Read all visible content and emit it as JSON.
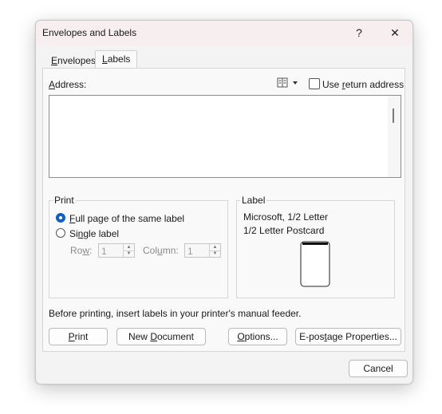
{
  "window": {
    "title": "Envelopes and Labels",
    "help_glyph": "?",
    "close_glyph": "✕"
  },
  "tabs": [
    {
      "label_pre": "",
      "label_ul": "E",
      "label_post": "nvelopes"
    },
    {
      "label_pre": "",
      "label_ul": "L",
      "label_post": "abels"
    }
  ],
  "address": {
    "label_pre": "",
    "label_ul": "A",
    "label_post": "ddress:",
    "value": "",
    "use_return": {
      "pre": "Use ",
      "ul": "r",
      "post": "eturn address",
      "checked": false
    }
  },
  "print_group": {
    "legend": "Print",
    "full_page": {
      "pre": "",
      "ul": "F",
      "post": "ull page of the same label",
      "selected": true
    },
    "single": {
      "pre": "Si",
      "ul": "n",
      "post": "gle label",
      "selected": false
    },
    "row": {
      "pre": "Ro",
      "ul": "w",
      "post": ":",
      "value": "1"
    },
    "column": {
      "pre": "Col",
      "ul": "u",
      "post": "mn:",
      "value": "1"
    }
  },
  "label_group": {
    "legend": "Label",
    "line1": "Microsoft, 1/2 Letter",
    "line2": "1/2 Letter Postcard"
  },
  "hint": "Before printing, insert labels in your printer's manual feeder.",
  "buttons": {
    "print": {
      "pre": "",
      "ul": "P",
      "post": "rint"
    },
    "new_document": {
      "pre": "New ",
      "ul": "D",
      "post": "ocument"
    },
    "options": {
      "pre": "",
      "ul": "O",
      "post": "ptions..."
    },
    "epostage": {
      "pre": "E-pos",
      "ul": "t",
      "post": "age Properties..."
    },
    "cancel": {
      "pre": "",
      "ul": "",
      "post": "Cancel"
    }
  }
}
